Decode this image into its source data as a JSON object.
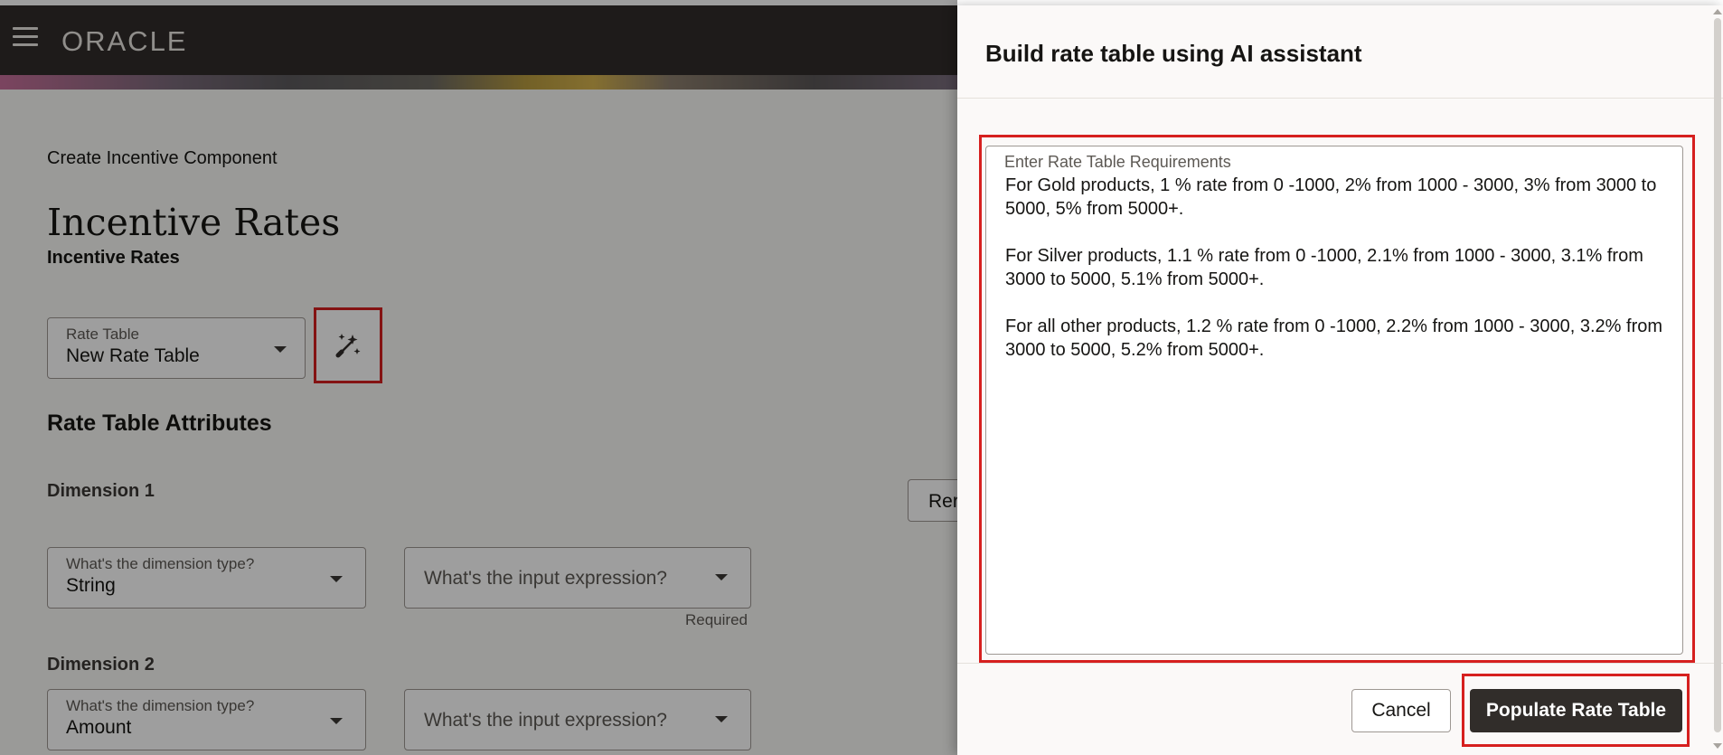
{
  "header": {
    "logo": "ORACLE"
  },
  "page": {
    "breadcrumb": "Create Incentive Component",
    "title": "Incentive Rates",
    "subtitle": "Incentive Rates",
    "rate_table": {
      "label": "Rate Table",
      "value": "New Rate Table"
    },
    "section_title": "Rate Table Attributes",
    "dimension1": {
      "label": "Dimension 1",
      "type_label": "What's the dimension type?",
      "type_value": "String",
      "expression_placeholder": "What's the input expression?",
      "required_text": "Required"
    },
    "dimension2": {
      "label": "Dimension 2",
      "type_label": "What's the dimension type?",
      "type_value": "Amount",
      "expression_placeholder": "What's the input expression?"
    },
    "partial_button": "Rer"
  },
  "drawer": {
    "title": "Build rate table using AI assistant",
    "requirements_label": "Enter Rate Table Requirements",
    "requirements_text": "For Gold products, 1 % rate from 0 -1000, 2% from 1000 - 3000, 3% from 3000 to 5000, 5% from 5000+.\n\nFor Silver products, 1.1 % rate from 0 -1000, 2.1% from 1000 - 3000, 3.1% from 3000 to 5000, 5.1% from 5000+.\n\nFor all other products, 1.2 % rate from 0 -1000, 2.2% from 1000 - 3000, 3.2% from 3000 to 5000, 5.2% from 5000+.",
    "cancel_label": "Cancel",
    "populate_label": "Populate Rate Table"
  },
  "colors": {
    "header_bg": "#312d2a",
    "highlight": "#d6201f",
    "primary_button": "#312d2a"
  },
  "icons": {
    "menu": "hamburger-icon",
    "ai": "magic-wand-icon",
    "dropdown": "caret-down-icon"
  }
}
